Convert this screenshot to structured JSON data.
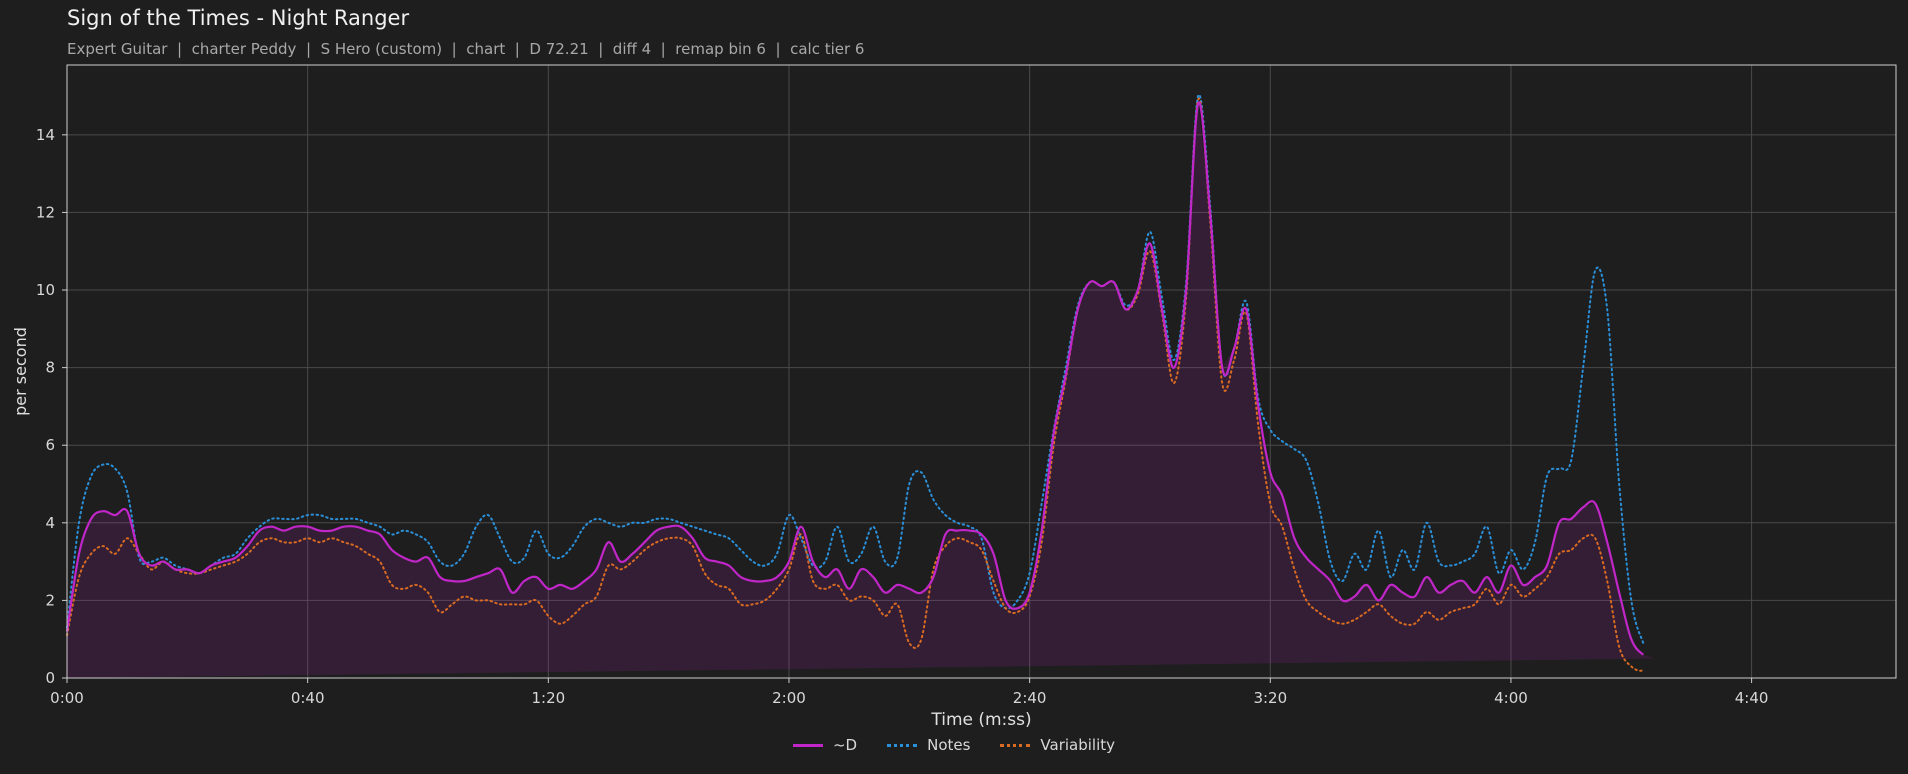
{
  "chart_data": {
    "type": "line",
    "title": "Sign of the Times - Night Ranger",
    "subtitle_parts": [
      "Expert Guitar",
      "charter Peddy",
      "S Hero (custom)",
      "chart",
      "D 72.21",
      "diff 4",
      "remap bin 6",
      "calc tier 6"
    ],
    "xlabel": "Time (m:ss)",
    "ylabel": "per second",
    "xlim": [
      0,
      304
    ],
    "ylim": [
      0,
      15.8
    ],
    "x_ticks": [
      0,
      40,
      80,
      120,
      160,
      200,
      240,
      280
    ],
    "x_tick_labels": [
      "0:00",
      "0:40",
      "1:20",
      "2:00",
      "2:40",
      "3:20",
      "4:00",
      "4:40"
    ],
    "y_ticks": [
      0,
      2,
      4,
      6,
      8,
      10,
      12,
      14
    ],
    "y_tick_labels": [
      "0",
      "2",
      "4",
      "6",
      "8",
      "10",
      "12",
      "14"
    ],
    "grid": true,
    "legend_position": "bottom-center",
    "x": [
      0,
      2,
      4,
      6,
      8,
      10,
      12,
      14,
      16,
      18,
      20,
      22,
      24,
      26,
      28,
      30,
      32,
      34,
      36,
      38,
      40,
      42,
      44,
      46,
      48,
      50,
      52,
      54,
      56,
      58,
      60,
      62,
      64,
      66,
      68,
      70,
      72,
      74,
      76,
      78,
      80,
      82,
      84,
      86,
      88,
      90,
      92,
      94,
      96,
      98,
      100,
      102,
      104,
      106,
      108,
      110,
      112,
      114,
      116,
      118,
      120,
      122,
      124,
      126,
      128,
      130,
      132,
      134,
      136,
      138,
      140,
      142,
      144,
      146,
      148,
      150,
      152,
      154,
      156,
      158,
      160,
      162,
      164,
      166,
      168,
      170,
      172,
      174,
      176,
      178,
      180,
      182,
      184,
      186,
      188,
      190,
      192,
      194,
      196,
      198,
      200,
      202,
      204,
      206,
      208,
      210,
      212,
      214,
      216,
      218,
      220,
      222,
      224,
      226,
      228,
      230,
      232,
      234,
      236,
      238,
      240,
      242,
      244,
      246,
      248,
      250,
      252,
      254,
      256,
      258,
      260,
      262,
      264,
      266,
      268,
      270,
      272,
      274,
      276,
      278,
      280,
      282,
      284,
      286,
      288,
      290,
      292,
      294,
      296,
      298,
      300,
      302,
      304
    ],
    "series": [
      {
        "name": "~D",
        "color": "#c026c8",
        "style": "solid",
        "fill": true,
        "values": [
          1.2,
          3.2,
          4.1,
          4.3,
          4.2,
          4.3,
          3.2,
          2.9,
          3.0,
          2.8,
          2.8,
          2.7,
          2.9,
          3.0,
          3.1,
          3.4,
          3.8,
          3.9,
          3.8,
          3.9,
          3.9,
          3.8,
          3.8,
          3.9,
          3.9,
          3.8,
          3.7,
          3.3,
          3.1,
          3.0,
          3.1,
          2.6,
          2.5,
          2.5,
          2.6,
          2.7,
          2.8,
          2.2,
          2.5,
          2.6,
          2.3,
          2.4,
          2.3,
          2.5,
          2.8,
          3.5,
          3.0,
          3.2,
          3.5,
          3.8,
          3.9,
          3.9,
          3.6,
          3.1,
          3.0,
          2.9,
          2.6,
          2.5,
          2.5,
          2.6,
          3.0,
          3.9,
          3.0,
          2.6,
          2.8,
          2.3,
          2.8,
          2.6,
          2.2,
          2.4,
          2.3,
          2.2,
          2.6,
          3.7,
          3.8,
          3.8,
          3.7,
          3.2,
          2.0,
          1.8,
          2.2,
          3.8,
          6.3,
          7.8,
          9.5,
          10.2,
          10.1,
          10.2,
          9.5,
          10.0,
          11.2,
          9.5,
          8.0,
          10.0,
          14.8,
          12.0,
          8.0,
          8.5,
          9.5,
          7.0,
          5.3,
          4.7,
          3.6,
          3.1,
          2.8,
          2.5,
          2.0,
          2.1,
          2.4,
          2.0,
          2.4,
          2.2,
          2.1,
          2.6,
          2.2,
          2.4,
          2.5,
          2.2,
          2.6,
          2.2,
          2.9,
          2.4,
          2.6,
          2.9,
          4.0,
          4.1,
          4.4,
          4.5,
          3.5,
          2.2,
          1.0,
          0.6,
          0.5
        ]
      },
      {
        "name": "Notes",
        "color": "#2b8fd8",
        "style": "dotted",
        "fill": false,
        "values": [
          1.3,
          4.0,
          5.2,
          5.5,
          5.4,
          4.8,
          3.1,
          3.0,
          3.1,
          2.9,
          2.8,
          2.7,
          2.9,
          3.1,
          3.2,
          3.6,
          3.9,
          4.1,
          4.1,
          4.1,
          4.2,
          4.2,
          4.1,
          4.1,
          4.1,
          4.0,
          3.9,
          3.7,
          3.8,
          3.7,
          3.5,
          3.0,
          2.9,
          3.2,
          3.9,
          4.2,
          3.6,
          3.0,
          3.1,
          3.8,
          3.2,
          3.1,
          3.4,
          3.9,
          4.1,
          4.0,
          3.9,
          4.0,
          4.0,
          4.1,
          4.1,
          4.0,
          3.9,
          3.8,
          3.7,
          3.6,
          3.3,
          3.0,
          2.9,
          3.2,
          4.2,
          3.6,
          2.9,
          3.0,
          3.9,
          3.0,
          3.2,
          3.9,
          3.0,
          3.1,
          5.0,
          5.3,
          4.6,
          4.2,
          4.0,
          3.9,
          3.6,
          2.2,
          1.8,
          2.0,
          2.7,
          4.5,
          6.4,
          8.0,
          9.6,
          10.2,
          10.1,
          10.2,
          9.6,
          10.0,
          11.5,
          9.8,
          8.2,
          10.2,
          15.0,
          12.2,
          8.0,
          8.5,
          9.7,
          7.2,
          6.4,
          6.1,
          5.9,
          5.6,
          4.5,
          3.0,
          2.5,
          3.2,
          2.8,
          3.8,
          2.6,
          3.3,
          2.8,
          4.0,
          3.0,
          2.9,
          3.0,
          3.2,
          3.9,
          2.7,
          3.3,
          2.8,
          3.5,
          5.2,
          5.4,
          5.6,
          8.0,
          10.5,
          9.5,
          5.0,
          2.0,
          0.9,
          0.3
        ]
      },
      {
        "name": "Variability",
        "color": "#d86a22",
        "style": "dotted",
        "fill": false,
        "values": [
          1.1,
          2.6,
          3.2,
          3.4,
          3.2,
          3.6,
          3.2,
          2.8,
          3.0,
          2.8,
          2.7,
          2.7,
          2.8,
          2.9,
          3.0,
          3.2,
          3.5,
          3.6,
          3.5,
          3.5,
          3.6,
          3.5,
          3.6,
          3.5,
          3.4,
          3.2,
          3.0,
          2.4,
          2.3,
          2.4,
          2.2,
          1.7,
          1.9,
          2.1,
          2.0,
          2.0,
          1.9,
          1.9,
          1.9,
          2.0,
          1.6,
          1.4,
          1.6,
          1.9,
          2.1,
          2.9,
          2.8,
          3.0,
          3.3,
          3.5,
          3.6,
          3.6,
          3.4,
          2.7,
          2.4,
          2.3,
          1.9,
          1.9,
          2.0,
          2.3,
          2.8,
          3.7,
          2.5,
          2.3,
          2.4,
          2.0,
          2.1,
          2.0,
          1.6,
          1.9,
          0.9,
          1.0,
          2.8,
          3.4,
          3.6,
          3.5,
          3.3,
          2.5,
          1.8,
          1.7,
          2.1,
          3.5,
          6.0,
          7.7,
          9.5,
          10.2,
          10.1,
          10.2,
          9.5,
          9.9,
          11.0,
          9.4,
          7.6,
          9.8,
          14.9,
          11.8,
          7.6,
          8.2,
          9.4,
          6.5,
          4.5,
          3.9,
          2.8,
          2.0,
          1.7,
          1.5,
          1.4,
          1.5,
          1.7,
          1.9,
          1.6,
          1.4,
          1.4,
          1.7,
          1.5,
          1.7,
          1.8,
          1.9,
          2.3,
          1.9,
          2.4,
          2.1,
          2.3,
          2.6,
          3.2,
          3.3,
          3.6,
          3.6,
          2.5,
          0.8,
          0.3,
          0.2,
          0.5
        ]
      }
    ]
  }
}
